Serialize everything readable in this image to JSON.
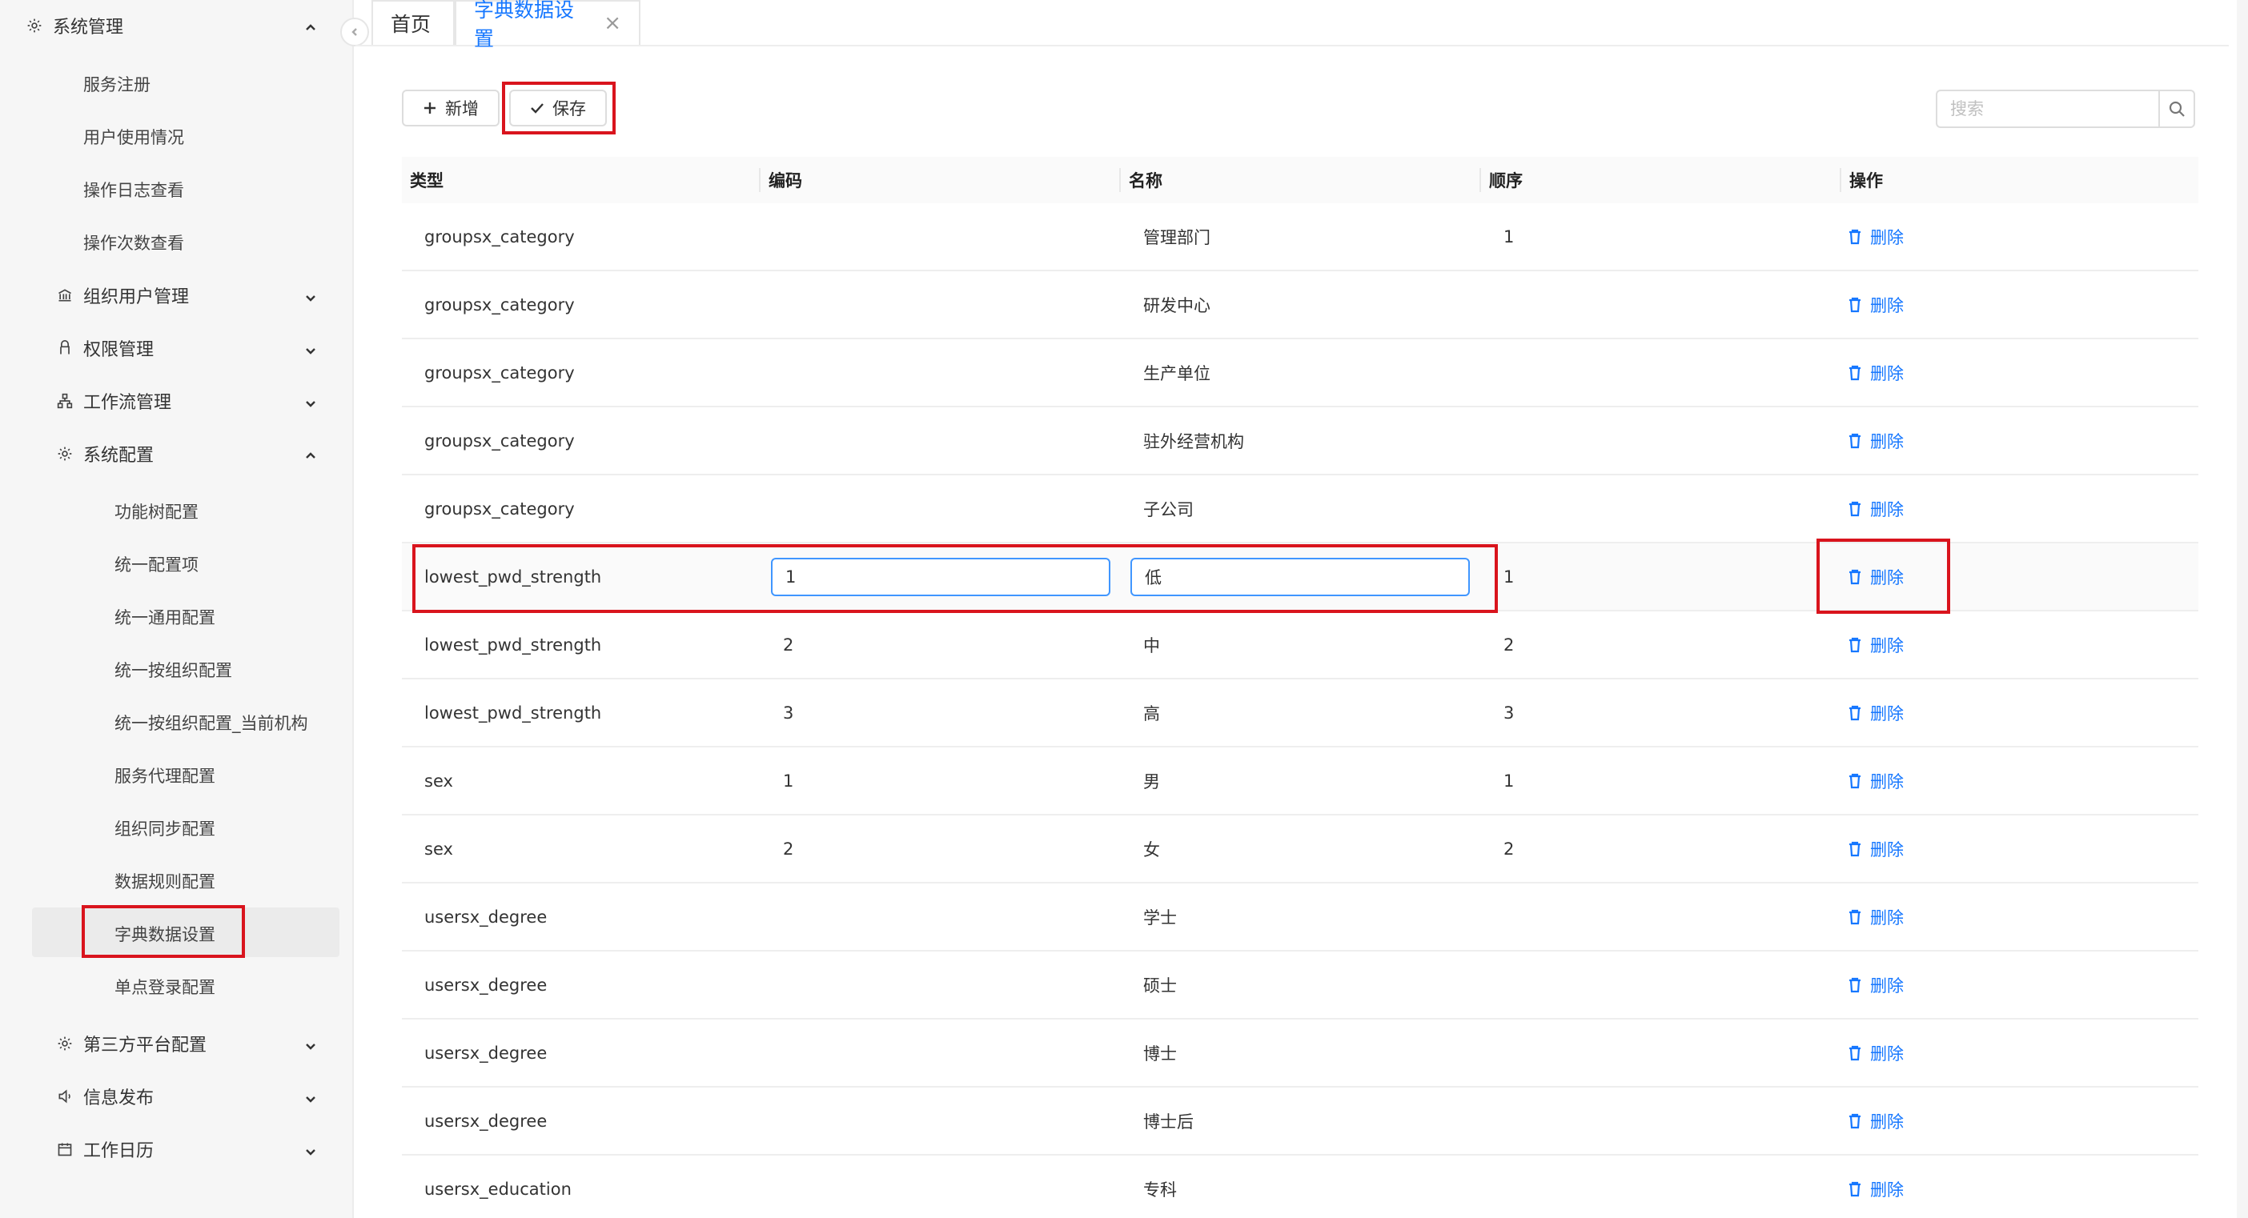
{
  "sidebar": {
    "system_mgmt": "系统管理",
    "service_register": "服务注册",
    "user_usage": "用户使用情况",
    "op_log": "操作日志查看",
    "op_count": "操作次数查看",
    "org_user_mgmt": "组织用户管理",
    "perm_mgmt": "权限管理",
    "workflow_mgmt": "工作流管理",
    "sys_config": "系统配置",
    "func_tree": "功能树配置",
    "unified_item": "统一配置项",
    "unified_general": "统一通用配置",
    "unified_org": "统一按组织配置",
    "unified_org_current": "统一按组织配置_当前机构",
    "service_proxy": "服务代理配置",
    "org_sync": "组织同步配置",
    "data_rule": "数据规则配置",
    "dict_data": "字典数据设置",
    "sso": "单点登录配置",
    "third_party": "第三方平台配置",
    "info_publish": "信息发布",
    "work_calendar": "工作日历"
  },
  "tabs": {
    "home": "首页",
    "dict": "字典数据设置",
    "close_glyph": "×"
  },
  "toolbar": {
    "add_label": "新增",
    "save_label": "保存",
    "search_placeholder": "搜索"
  },
  "table": {
    "headers": {
      "type": "类型",
      "code": "编码",
      "name": "名称",
      "order": "顺序",
      "action": "操作"
    },
    "delete_label": "删除",
    "rows": [
      {
        "type": "groupsx_category",
        "code": "",
        "name": "管理部门",
        "order": "1"
      },
      {
        "type": "groupsx_category",
        "code": "",
        "name": "研发中心",
        "order": ""
      },
      {
        "type": "groupsx_category",
        "code": "",
        "name": "生产单位",
        "order": ""
      },
      {
        "type": "groupsx_category",
        "code": "",
        "name": "驻外经营机构",
        "order": ""
      },
      {
        "type": "groupsx_category",
        "code": "",
        "name": "子公司",
        "order": ""
      },
      {
        "type": "lowest_pwd_strength",
        "code": "1",
        "name": "低",
        "order": "1"
      },
      {
        "type": "lowest_pwd_strength",
        "code": "2",
        "name": "中",
        "order": "2"
      },
      {
        "type": "lowest_pwd_strength",
        "code": "3",
        "name": "高",
        "order": "3"
      },
      {
        "type": "sex",
        "code": "1",
        "name": "男",
        "order": "1"
      },
      {
        "type": "sex",
        "code": "2",
        "name": "女",
        "order": "2"
      },
      {
        "type": "usersx_degree",
        "code": "",
        "name": "学士",
        "order": ""
      },
      {
        "type": "usersx_degree",
        "code": "",
        "name": "硕士",
        "order": ""
      },
      {
        "type": "usersx_degree",
        "code": "",
        "name": "博士",
        "order": ""
      },
      {
        "type": "usersx_degree",
        "code": "",
        "name": "博士后",
        "order": ""
      },
      {
        "type": "usersx_education",
        "code": "",
        "name": "专科",
        "order": ""
      }
    ]
  },
  "colors": {
    "accent": "#1677ff",
    "highlight": "#d9141d"
  }
}
